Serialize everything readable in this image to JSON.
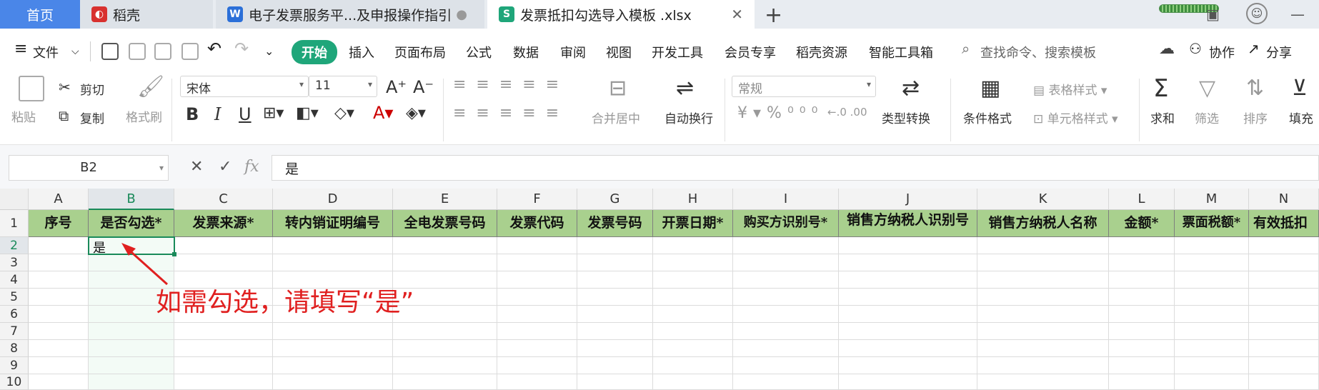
{
  "tabs": {
    "home": "首页",
    "tab2": "稻壳",
    "tab3": "电子发票服务平...及申报操作指引",
    "tab4": "发票抵扣勾选导入模板 .xlsx",
    "new_tab": "+"
  },
  "menubar": {
    "file": "文件",
    "items": [
      "开始",
      "插入",
      "页面布局",
      "公式",
      "数据",
      "审阅",
      "视图",
      "开发工具",
      "会员专享",
      "稻壳资源",
      "智能工具箱"
    ],
    "search_placeholder": "查找命令、搜索模板",
    "collab": "协作",
    "share": "分享"
  },
  "ribbon": {
    "paste": "粘贴",
    "cut": "剪切",
    "copy": "复制",
    "format_painter": "格式刷",
    "font_name": "宋体",
    "font_size": "11",
    "merge_center": "合并居中",
    "wrap_text": "自动换行",
    "number_format": "常规",
    "type_convert": "类型转换",
    "cond_format": "条件格式",
    "table_style": "表格样式",
    "cell_style": "单元格样式",
    "sum": "求和",
    "filter": "筛选",
    "sort": "排序",
    "fill": "填充"
  },
  "formula_bar": {
    "name_box": "B2",
    "fx": "fx",
    "value": "是"
  },
  "grid": {
    "columns": [
      "A",
      "B",
      "C",
      "D",
      "E",
      "F",
      "G",
      "H",
      "I",
      "J",
      "K",
      "L",
      "M",
      "N"
    ],
    "rows": [
      "1",
      "2",
      "3",
      "4",
      "5",
      "6",
      "7",
      "8",
      "9",
      "10"
    ],
    "headers": [
      "序号",
      "是否勾选*",
      "发票来源*",
      "转内销证明编号",
      "全电发票号码",
      "发票代码",
      "发票号码",
      "开票日期*",
      "购买方识别号*",
      "销售方纳税人识别号",
      "销售方纳税人名称",
      "金额*",
      "票面税额*",
      "有效抵扣"
    ],
    "b2_value": "是",
    "annotation": "如需勾选，请填写“是”"
  },
  "colors": {
    "accent_green": "#1fa67a",
    "header_fill": "#a9d08e",
    "annotation_red": "#e02020",
    "home_tab": "#4a86e8"
  }
}
